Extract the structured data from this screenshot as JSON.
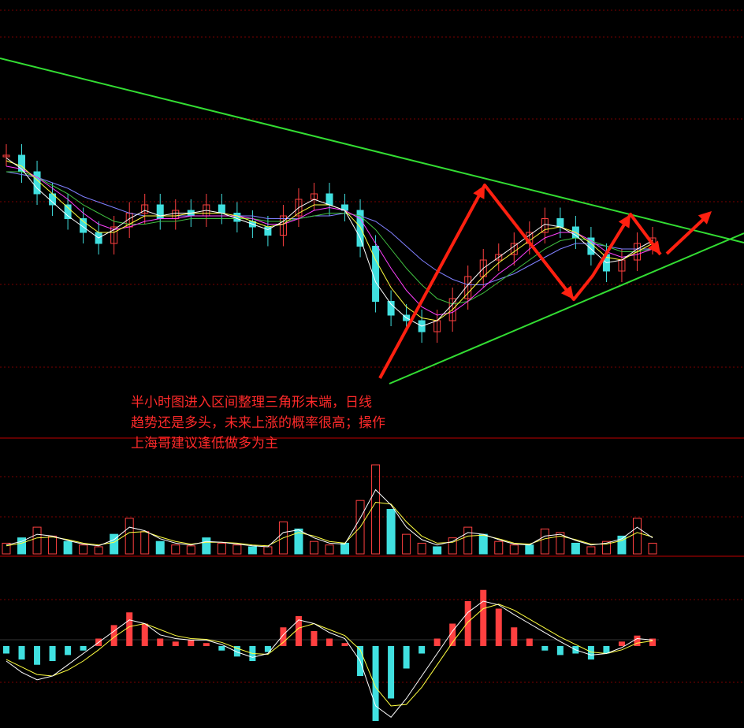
{
  "annotation": {
    "line1": "半小时图进入区间整理三角形末端，日线",
    "line2": "趋势还是多头，未来上涨的概率很高；操作",
    "line3": "上海哥建议逢低做多为主"
  },
  "colors": {
    "background": "#000000",
    "grid": "#7a0000",
    "separator": "#c00000",
    "up": "#ff4040",
    "down": "#40e0e0",
    "trendline": "#33dd33",
    "arrow": "#ff2010",
    "ma_white": "#ffffff",
    "ma_yellow": "#ffff40",
    "ma_magenta": "#ff40ff",
    "ma_green": "#40c040",
    "ma_blue": "#8080ff"
  },
  "chart_data": [
    {
      "type": "candlestick",
      "panel": "price",
      "ylim": [
        0,
        100
      ],
      "grid": true,
      "x": [
        0,
        5,
        10,
        15,
        20,
        25,
        30,
        35,
        40,
        45,
        50,
        55,
        60,
        65,
        70,
        75,
        80,
        85,
        90,
        95,
        100,
        105,
        110,
        115,
        120,
        125,
        130,
        135,
        140,
        145,
        150,
        155,
        160,
        165,
        170,
        175,
        180,
        185,
        190,
        195,
        200,
        205,
        210
      ],
      "close": [
        78,
        72,
        64,
        60,
        55,
        50,
        46,
        52,
        57,
        60,
        55,
        58,
        56,
        60,
        57,
        54,
        52,
        49,
        56,
        62,
        64,
        60,
        58,
        45,
        25,
        20,
        18,
        14,
        18,
        26,
        34,
        40,
        42,
        46,
        50,
        55,
        52,
        48,
        42,
        36,
        40,
        46,
        48
      ],
      "ma_white": [
        77,
        73,
        66,
        61,
        56,
        52,
        48,
        51,
        55,
        58,
        56,
        57,
        57,
        58,
        57,
        55,
        53,
        51,
        54,
        59,
        62,
        60,
        58,
        48,
        32,
        24,
        19,
        16,
        18,
        24,
        31,
        37,
        41,
        45,
        49,
        53,
        52,
        49,
        44,
        39,
        40,
        44,
        47
      ],
      "ma_yellow": [
        76,
        74,
        69,
        64,
        59,
        54,
        50,
        50,
        53,
        56,
        56,
        56,
        57,
        57,
        57,
        56,
        54,
        52,
        53,
        57,
        60,
        60,
        58,
        52,
        40,
        30,
        23,
        19,
        18,
        22,
        28,
        34,
        39,
        43,
        47,
        51,
        52,
        50,
        46,
        41,
        40,
        43,
        46
      ],
      "ma_magenta": [
        74,
        73,
        70,
        66,
        62,
        57,
        53,
        51,
        52,
        54,
        55,
        55,
        56,
        56,
        56,
        56,
        55,
        53,
        53,
        55,
        58,
        59,
        58,
        55,
        46,
        37,
        29,
        23,
        20,
        21,
        25,
        30,
        35,
        39,
        44,
        48,
        50,
        50,
        47,
        43,
        41,
        42,
        44
      ],
      "ma_green": [
        72,
        72,
        70,
        67,
        64,
        60,
        57,
        54,
        53,
        53,
        54,
        54,
        55,
        55,
        55,
        55,
        55,
        54,
        54,
        55,
        56,
        57,
        57,
        56,
        51,
        44,
        37,
        31,
        26,
        24,
        25,
        28,
        32,
        36,
        40,
        44,
        47,
        48,
        47,
        45,
        43,
        43,
        44
      ],
      "ma_blue": [
        72,
        71,
        70,
        68,
        66,
        63,
        61,
        59,
        57,
        56,
        56,
        56,
        56,
        56,
        56,
        56,
        56,
        55,
        55,
        55,
        56,
        56,
        57,
        56,
        54,
        50,
        45,
        40,
        36,
        33,
        31,
        31,
        33,
        35,
        38,
        41,
        44,
        46,
        46,
        45,
        44,
        44,
        44
      ]
    },
    {
      "type": "bar",
      "panel": "volume",
      "ylim": [
        0,
        100
      ],
      "x": [
        0,
        5,
        10,
        15,
        20,
        25,
        30,
        35,
        40,
        45,
        50,
        55,
        60,
        65,
        70,
        75,
        80,
        85,
        90,
        95,
        100,
        105,
        110,
        115,
        120,
        125,
        130,
        135,
        140,
        145,
        150,
        155,
        160,
        165,
        170,
        175,
        180,
        185,
        190,
        195,
        200,
        205,
        210
      ],
      "values": [
        12,
        18,
        30,
        20,
        14,
        10,
        8,
        22,
        40,
        25,
        14,
        10,
        9,
        18,
        12,
        10,
        8,
        8,
        36,
        28,
        14,
        10,
        12,
        60,
        100,
        50,
        22,
        12,
        8,
        18,
        30,
        22,
        14,
        10,
        10,
        28,
        24,
        12,
        8,
        14,
        20,
        40,
        12
      ],
      "ma_white": [
        10,
        14,
        22,
        20,
        15,
        11,
        9,
        16,
        30,
        26,
        17,
        12,
        10,
        14,
        13,
        11,
        9,
        8,
        24,
        27,
        18,
        12,
        11,
        40,
        72,
        55,
        30,
        16,
        10,
        14,
        24,
        22,
        16,
        11,
        10,
        20,
        22,
        15,
        10,
        12,
        17,
        30,
        18
      ],
      "ma_yellow": [
        9,
        12,
        18,
        19,
        16,
        12,
        10,
        13,
        24,
        25,
        19,
        14,
        11,
        13,
        13,
        12,
        10,
        9,
        18,
        24,
        20,
        14,
        12,
        30,
        58,
        56,
        36,
        20,
        12,
        13,
        20,
        21,
        17,
        12,
        11,
        17,
        20,
        16,
        11,
        11,
        15,
        24,
        19
      ]
    },
    {
      "type": "bar",
      "panel": "macd",
      "ylim": [
        -100,
        100
      ],
      "x": [
        0,
        5,
        10,
        15,
        20,
        25,
        30,
        35,
        40,
        45,
        50,
        55,
        60,
        65,
        70,
        75,
        80,
        85,
        90,
        95,
        100,
        105,
        110,
        115,
        120,
        125,
        130,
        135,
        140,
        145,
        150,
        155,
        160,
        165,
        170,
        175,
        180,
        185,
        190,
        195,
        200,
        205,
        210
      ],
      "values": [
        -10,
        -18,
        -25,
        -20,
        -12,
        -6,
        10,
        28,
        45,
        30,
        10,
        6,
        8,
        4,
        -6,
        -14,
        -20,
        -8,
        25,
        40,
        20,
        10,
        4,
        -40,
        -100,
        -70,
        -30,
        -10,
        10,
        30,
        60,
        75,
        50,
        25,
        10,
        -6,
        -12,
        -10,
        -18,
        -10,
        6,
        14,
        10
      ],
      "ma_white": [
        -20,
        -35,
        -45,
        -40,
        -25,
        -10,
        5,
        20,
        35,
        30,
        15,
        10,
        8,
        8,
        2,
        -8,
        -15,
        -10,
        15,
        35,
        30,
        18,
        10,
        -20,
        -80,
        -95,
        -70,
        -40,
        -10,
        20,
        45,
        60,
        55,
        42,
        30,
        18,
        6,
        -5,
        -12,
        -10,
        -2,
        10,
        8
      ],
      "ma_yellow": [
        -18,
        -28,
        -38,
        -40,
        -32,
        -20,
        -5,
        12,
        26,
        30,
        22,
        14,
        10,
        9,
        5,
        -3,
        -10,
        -11,
        5,
        24,
        30,
        22,
        14,
        -5,
        -55,
        -80,
        -78,
        -55,
        -25,
        5,
        32,
        50,
        56,
        48,
        36,
        24,
        12,
        2,
        -8,
        -10,
        -5,
        4,
        7
      ]
    }
  ]
}
